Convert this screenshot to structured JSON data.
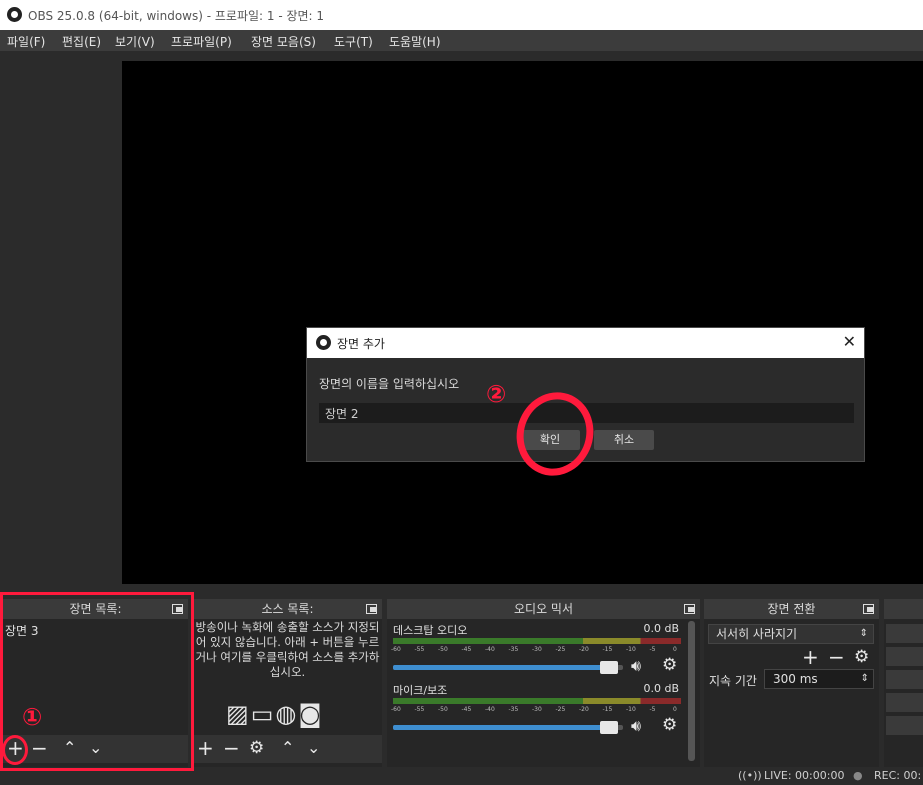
{
  "window": {
    "title": "OBS 25.0.8 (64-bit, windows) - 프로파일: 1 - 장면: 1"
  },
  "menu": [
    "파일(F)",
    "편집(E)",
    "보기(V)",
    "프로파일(P)",
    "장면 모음(S)",
    "도구(T)",
    "도움말(H)"
  ],
  "dialog": {
    "title": "장면 추가",
    "prompt": "장면의 이름을 입력하십시오",
    "value": "장면 2",
    "ok": "확인",
    "cancel": "취소"
  },
  "scenes": {
    "header": "장면 목록:",
    "items": [
      "장면 3"
    ]
  },
  "sources": {
    "header": "소스 목록:",
    "empty_text": "방송이나 녹화에 송출할 소스가 지정되어 있지 않습니다. 아래 + 버튼을 누르거나 여기를 우클릭하여 소스를 추가하십시오."
  },
  "mixer": {
    "header": "오디오 믹서",
    "ticks": [
      "-60",
      "-55",
      "-50",
      "-45",
      "-40",
      "-35",
      "-30",
      "-25",
      "-20",
      "-15",
      "-10",
      "-5",
      "0"
    ],
    "channels": [
      {
        "name": "데스크탑 오디오",
        "level": "0.0 dB",
        "volume": 0.98
      },
      {
        "name": "마이크/보조",
        "level": "0.0 dB",
        "volume": 0.98
      }
    ]
  },
  "transitions": {
    "header": "장면 전환",
    "selected": "서서히 사라지기",
    "duration_label": "지속 기간",
    "duration_value": "300 ms"
  },
  "status": {
    "live": "LIVE: 00:00:00",
    "rec": "REC: 00:"
  },
  "annotations": {
    "step1": "①",
    "step2": "②"
  },
  "colors": {
    "accent": "#ff1a3c",
    "selection": "#3a6fb0"
  }
}
